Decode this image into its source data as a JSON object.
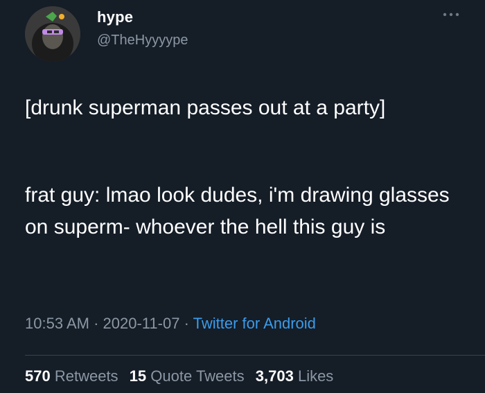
{
  "author": {
    "display_name": "hype",
    "handle": "@TheHyyyype"
  },
  "tweet": {
    "paragraphs": [
      "[drunk superman passes out at a party]",
      "frat guy: lmao look dudes, i'm drawing glasses on superm- whoever the hell this guy is"
    ],
    "time": "10:53 AM",
    "separator": "·",
    "date": "2020-11-07",
    "source": "Twitter for Android"
  },
  "stats": {
    "retweets_count": "570",
    "retweets_label": "Retweets",
    "quotes_count": "15",
    "quotes_label": "Quote Tweets",
    "likes_count": "3,703",
    "likes_label": "Likes"
  },
  "icons": {
    "more": "more-options-icon"
  },
  "colors": {
    "background": "#151d27",
    "secondary_text": "#8b98a5",
    "link": "#3b9ceb"
  }
}
